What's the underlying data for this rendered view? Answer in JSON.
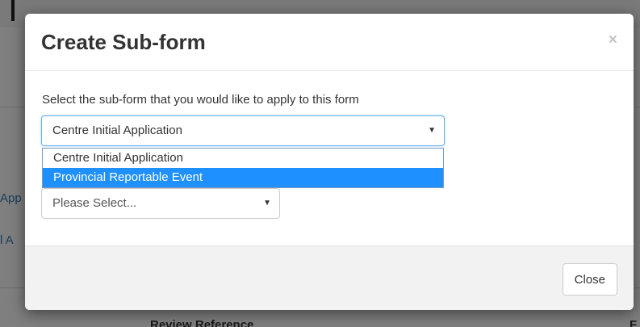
{
  "background": {
    "fragment_1": "App",
    "fragment_2": "l A",
    "fragment_3": "Review Reference",
    "fragment_4": "F"
  },
  "modal": {
    "title": "Create Sub-form",
    "close_icon": "×",
    "instruction": "Select the sub-form that you would like to apply to this form",
    "primary_select": {
      "value": "Centre Initial Application",
      "caret": "▼",
      "options": [
        "Centre Initial Application",
        "Provincial Reportable Event"
      ],
      "highlighted_index": 1
    },
    "secondary_select": {
      "value": "Please Select...",
      "caret": "▼"
    },
    "footer": {
      "close_label": "Close"
    }
  },
  "colors": {
    "option_highlight": "#1e90ff",
    "select_focus_border": "#66afe9",
    "overlay": "rgba(0,0,0,0.5)"
  }
}
